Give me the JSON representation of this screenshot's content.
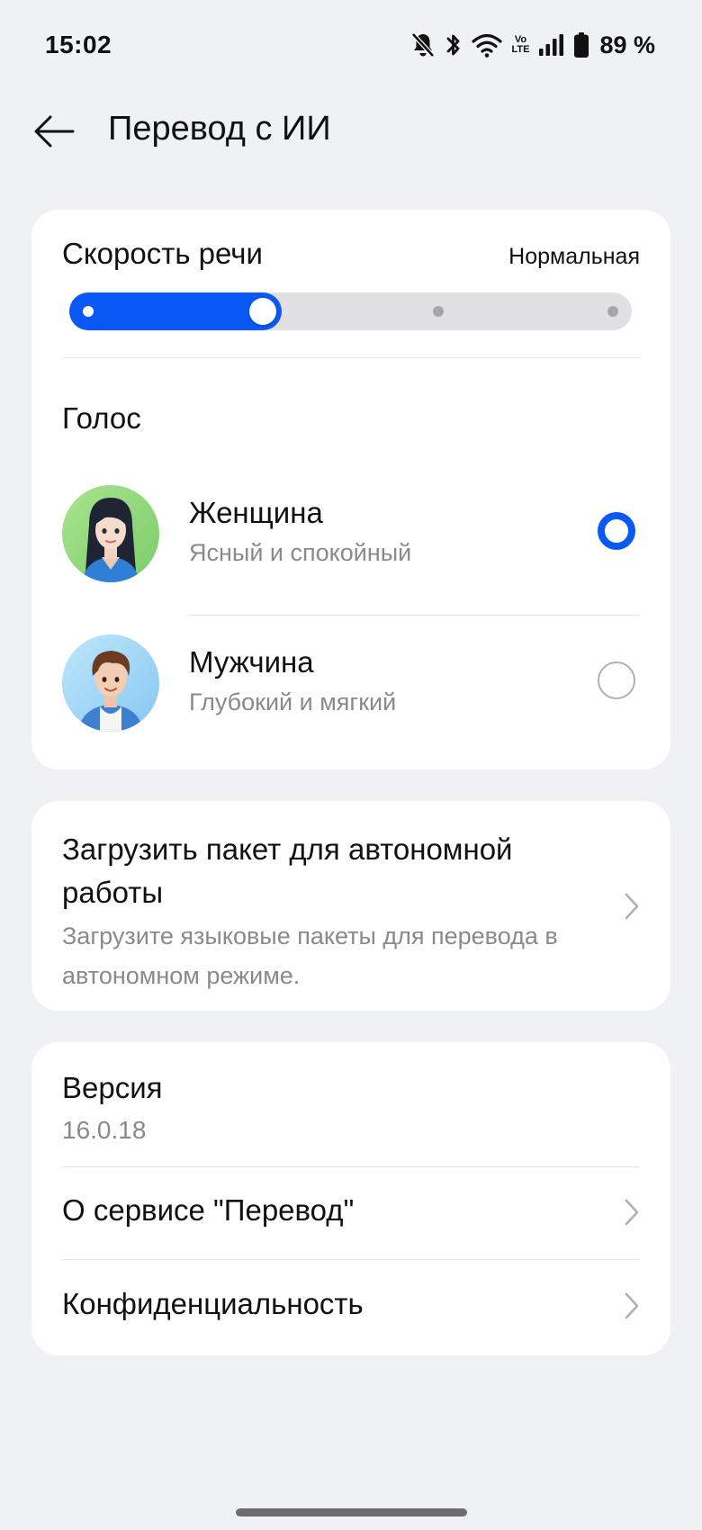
{
  "status_bar": {
    "time": "15:02",
    "volte_top": "Vo",
    "volte_bottom": "LTE",
    "battery": "89 %",
    "battery_level": 0.89,
    "icons": [
      "mute-bell-icon",
      "bluetooth-icon",
      "wifi-icon",
      "volte-icon",
      "signal-icon",
      "battery-icon"
    ]
  },
  "app_bar": {
    "back_icon": "arrow-left-icon",
    "title": "Перевод с ИИ"
  },
  "speech": {
    "title": "Скорость речи",
    "value": "Нормальная",
    "slider_steps": 4,
    "slider_selected_step": 2,
    "accent_color": "#0a59f7"
  },
  "voice": {
    "title": "Голос",
    "options": [
      {
        "name": "Женщина",
        "description": "Ясный и спокойный",
        "selected": true
      },
      {
        "name": "Мужчина",
        "description": "Глубокий и мягкий",
        "selected": false
      }
    ]
  },
  "offline": {
    "title": "Загрузить пакет для автономной работы",
    "description": "Загрузите языковые пакеты для перевода в автономном режиме.",
    "chevron_icon": "chevron-right-icon"
  },
  "info": {
    "version_label": "Версия",
    "version_value": "16.0.18",
    "about_label": "О сервисе \"Перевод\"",
    "privacy_label": "Конфиденциальность"
  }
}
